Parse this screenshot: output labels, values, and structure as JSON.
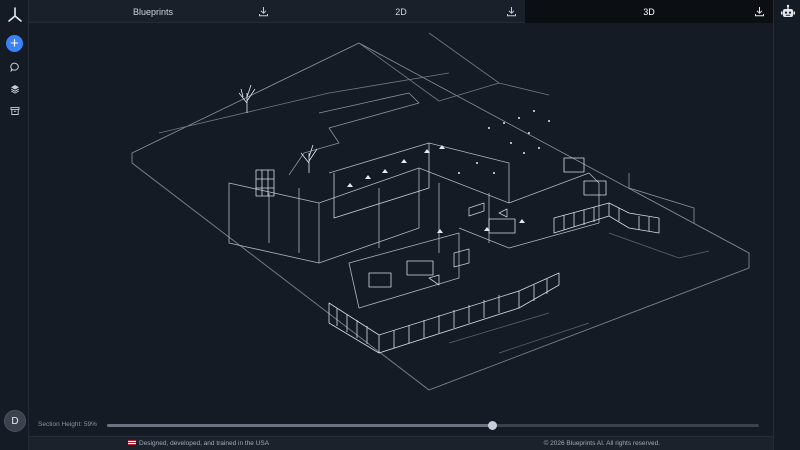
{
  "tabs": [
    {
      "label": "Blueprints",
      "active": false
    },
    {
      "label": "2D",
      "active": false
    },
    {
      "label": "3D",
      "active": true
    }
  ],
  "sidebar": {
    "logo": "blueprints-logo-icon",
    "actions": [
      "add-icon",
      "chat-icon",
      "layers-icon",
      "archive-icon"
    ],
    "avatar_initial": "D",
    "accent": "#3b82f6"
  },
  "section": {
    "label": "Section Height: 59%",
    "value": 0.59
  },
  "footer": {
    "left": "Designed, developed, and trained in the USA",
    "right": "© 2026 Blueprints AI. All rights reserved."
  }
}
